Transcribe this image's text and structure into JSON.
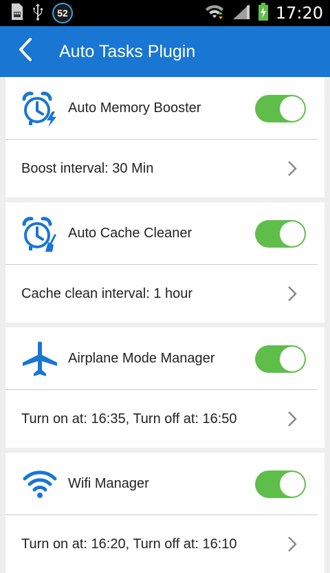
{
  "status_bar": {
    "notification_count": "52",
    "time": "17:20",
    "icons": [
      "sd-card-icon",
      "usb-icon",
      "notification-badge",
      "wifi-icon",
      "signal-icon",
      "battery-charging-icon"
    ]
  },
  "app_bar": {
    "title": "Auto Tasks Plugin",
    "back_icon": "back-arrow-icon"
  },
  "colors": {
    "primary": "#1976d2",
    "toggle_on": "#5fbe4a",
    "icon_blue": "#1976d2"
  },
  "tasks": [
    {
      "title": "Auto Memory Booster",
      "icon": "alarm-clock-bolt-icon",
      "enabled": true,
      "detail": "Boost interval: 30 Min"
    },
    {
      "title": "Auto Cache Cleaner",
      "icon": "alarm-clock-broom-icon",
      "enabled": true,
      "detail": "Cache clean interval: 1 hour"
    },
    {
      "title": "Airplane Mode Manager",
      "icon": "airplane-icon",
      "enabled": true,
      "detail": "Turn on at: 16:35, Turn off at: 16:50"
    },
    {
      "title": "Wifi Manager",
      "icon": "wifi-icon",
      "enabled": true,
      "detail": "Turn on at: 16:20, Turn off at: 16:10"
    }
  ]
}
